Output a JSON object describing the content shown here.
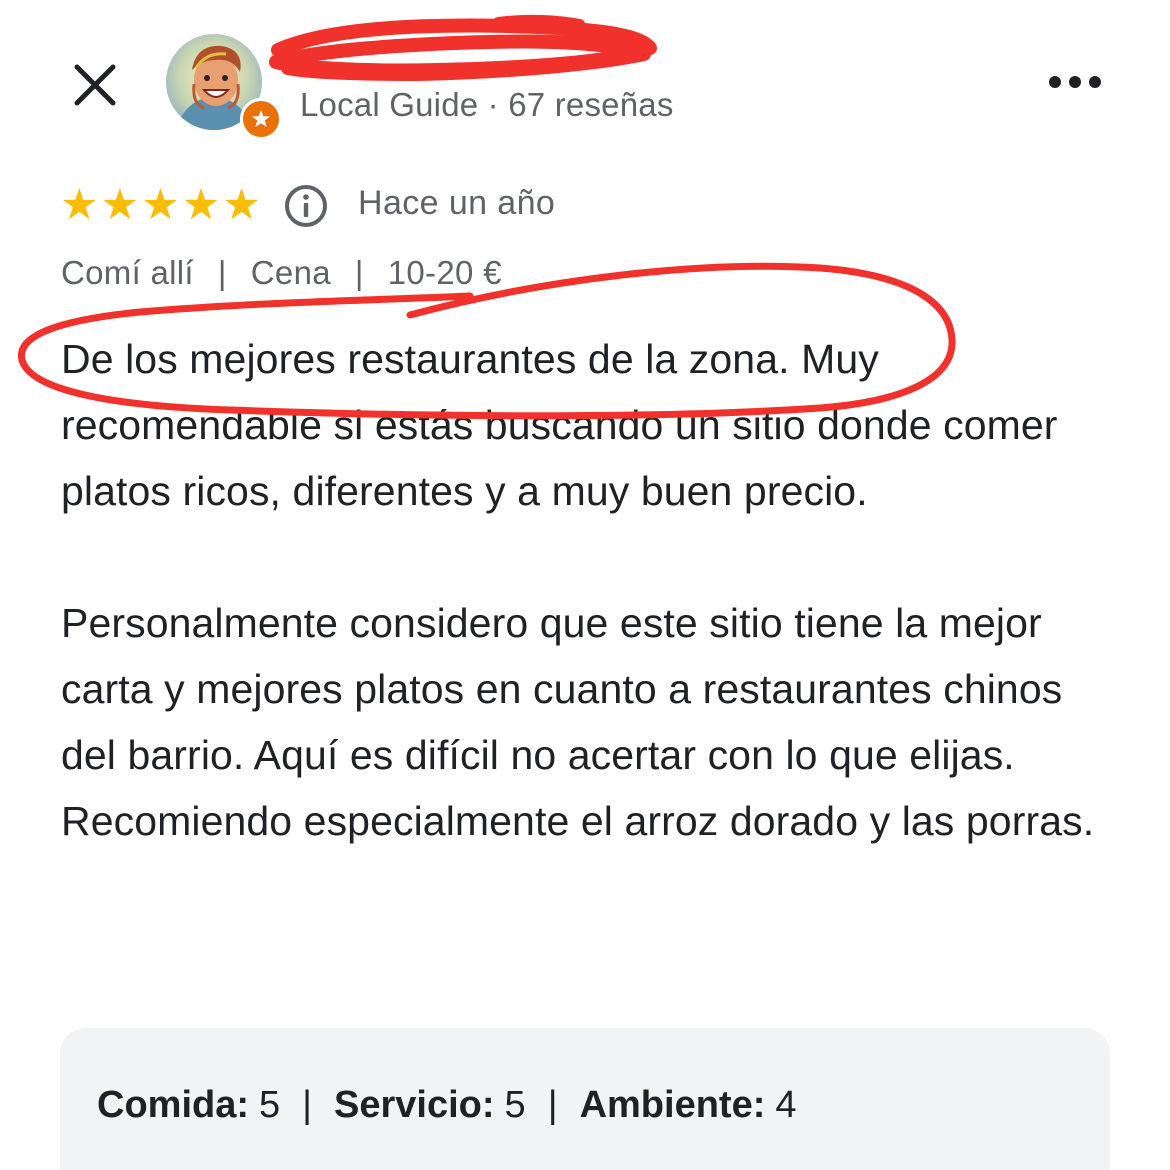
{
  "header": {
    "author_name": "",
    "author_meta": "Local Guide · 67 reseñas",
    "close_icon": "close-icon",
    "more_icon": "more-horizontal-icon"
  },
  "rating": {
    "stars": 5,
    "star_glyphs": [
      "★",
      "★",
      "★",
      "★",
      "★"
    ],
    "date": "Hace un año"
  },
  "tags": {
    "items": [
      "Comí allí",
      "Cena",
      "10-20 €"
    ],
    "separator": "|"
  },
  "review": {
    "paragraphs": [
      "De los mejores restaurantes de la zona. Muy recomendable si estás buscando un sitio donde comer platos ricos, diferentes y a muy buen precio.",
      "Personalmente considero que este sitio tiene la mejor carta y mejores platos en cuanto a restaurantes chinos del barrio.  Aquí es difícil no acertar con lo que elijas. Recomiendo especialmente el arroz dorado y las porras."
    ]
  },
  "attributes": [
    {
      "label": "Comida:",
      "value": "5"
    },
    {
      "label": "Servicio:",
      "value": "5"
    },
    {
      "label": "Ambiente:",
      "value": "4"
    }
  ],
  "attributes_separator": "|",
  "colors": {
    "star": "#fbbc04",
    "local_guide_badge": "#e8710a",
    "annotation_red": "#f0312c",
    "secondary_text": "#5f6368",
    "attr_background": "#f1f3f4"
  }
}
